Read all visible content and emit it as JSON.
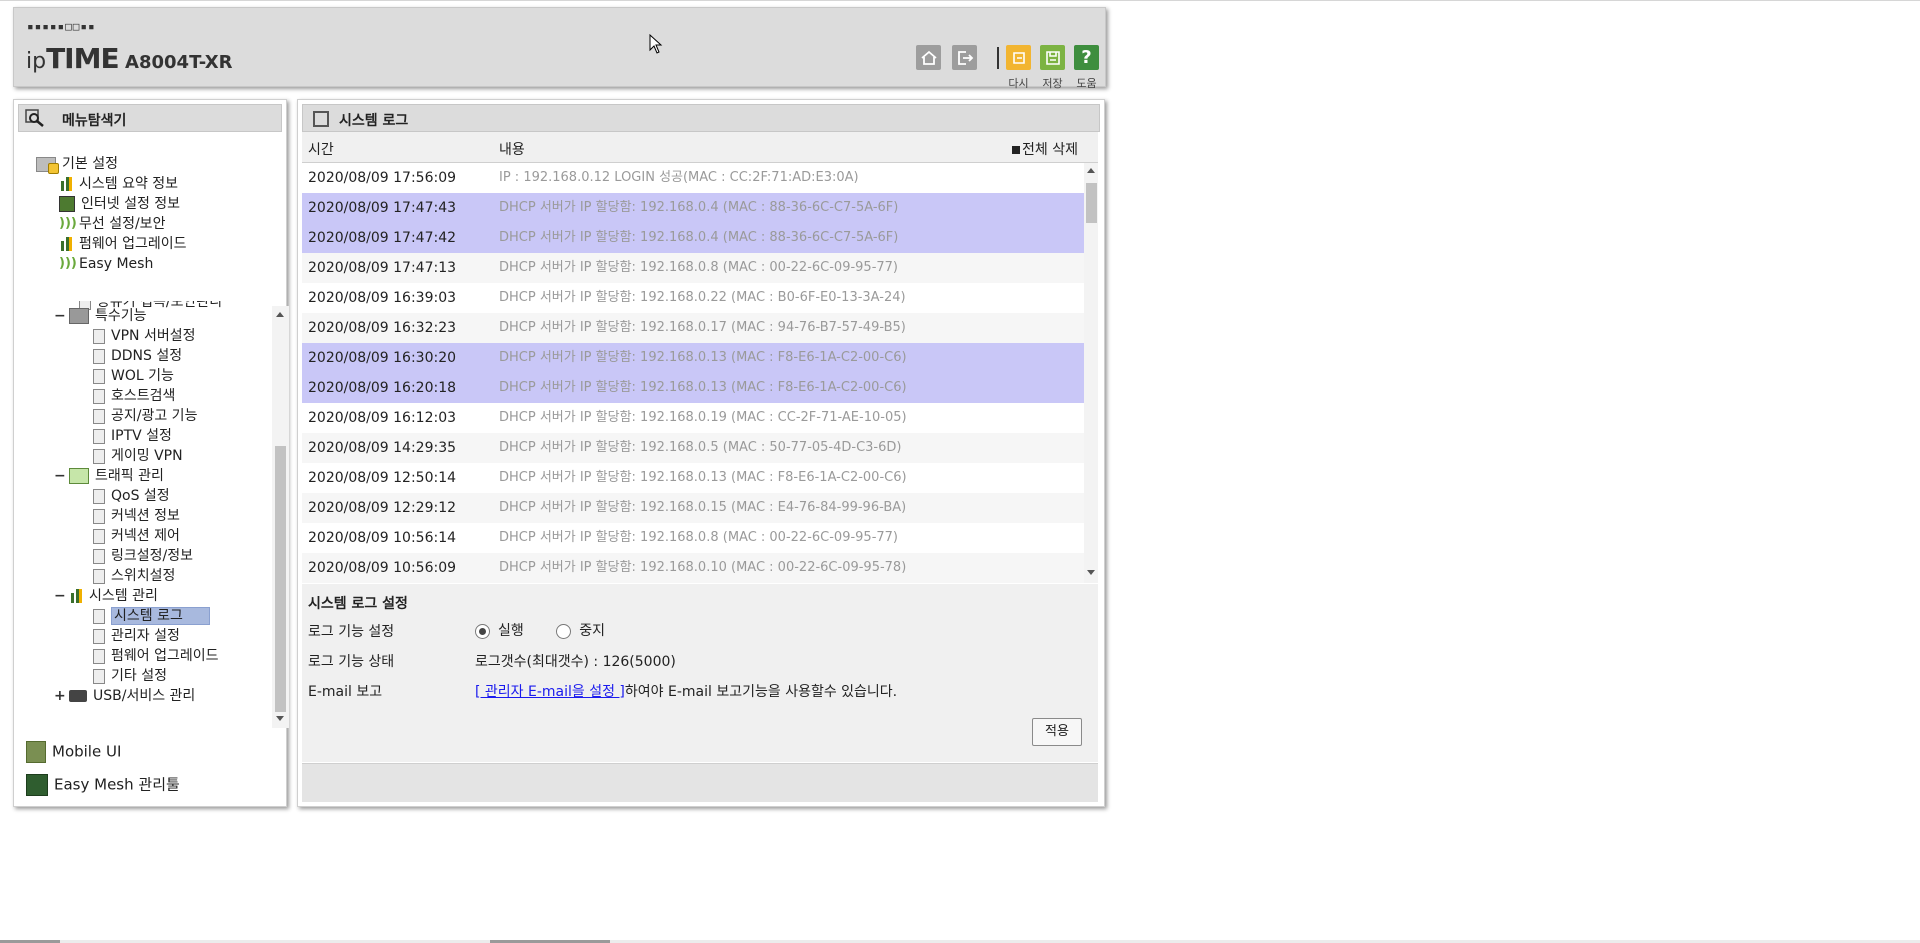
{
  "header": {
    "logo_dots": "▪▪▪▪▪□□▪▪",
    "logo_ip": "ip",
    "logo_time": "TIME",
    "model": "A8004T-XR",
    "buttons": [
      {
        "name": "home",
        "icon": "home-icon",
        "label": ""
      },
      {
        "name": "logout",
        "icon": "logout-icon",
        "label": ""
      },
      {
        "name": "reload",
        "icon": "reload-icon",
        "label": "다시"
      },
      {
        "name": "save",
        "icon": "save-icon",
        "label": "저장"
      },
      {
        "name": "help",
        "icon": "help-icon",
        "label": "도움",
        "glyph": "?"
      }
    ]
  },
  "left": {
    "title": "메뉴탐색기",
    "favorites": {
      "root": "기본 설정",
      "items": [
        "시스템 요약 정보",
        "인터넷 설정 정보",
        "무선 설정/보안",
        "펌웨어 업그레이드",
        "Easy Mesh"
      ]
    },
    "tree": {
      "cut_item": "공유기 접속/보안관리",
      "special": {
        "label": "특수기능",
        "items": [
          "VPN 서버설정",
          "DDNS 설정",
          "WOL 기능",
          "호스트검색",
          "공지/광고 기능",
          "IPTV 설정",
          "게이밍 VPN"
        ]
      },
      "traffic": {
        "label": "트래픽 관리",
        "items": [
          "QoS 설정",
          "커넥션 정보",
          "커넥션 제어",
          "링크설정/정보",
          "스위치설정"
        ]
      },
      "system": {
        "label": "시스템 관리",
        "items": [
          "시스템 로그",
          "관리자 설정",
          "펌웨어 업그레이드",
          "기타 설정"
        ]
      },
      "usb": {
        "label": "USB/서비스 관리"
      }
    },
    "links": [
      "Mobile UI",
      "Easy Mesh 관리툴"
    ]
  },
  "main": {
    "title": "시스템 로그",
    "col_time": "시간",
    "col_msg": "내용",
    "delete_all": "전체 삭제",
    "rows": [
      {
        "time": "2020/08/09 17:56:09",
        "msg": "IP : 192.168.0.12 LOGIN 성공(MAC : CC:2F:71:AD:E3:0A)",
        "hl": false
      },
      {
        "time": "2020/08/09 17:47:43",
        "msg": "DHCP 서버가 IP 할당함: 192.168.0.4 (MAC : 88-36-6C-C7-5A-6F)",
        "hl": true
      },
      {
        "time": "2020/08/09 17:47:42",
        "msg": "DHCP 서버가 IP 할당함: 192.168.0.4 (MAC : 88-36-6C-C7-5A-6F)",
        "hl": true
      },
      {
        "time": "2020/08/09 17:47:13",
        "msg": "DHCP 서버가 IP 할당함: 192.168.0.8 (MAC : 00-22-6C-09-95-77)",
        "hl": false
      },
      {
        "time": "2020/08/09 16:39:03",
        "msg": "DHCP 서버가 IP 할당함: 192.168.0.22 (MAC : B0-6F-E0-13-3A-24)",
        "hl": false
      },
      {
        "time": "2020/08/09 16:32:23",
        "msg": "DHCP 서버가 IP 할당함: 192.168.0.17 (MAC : 94-76-B7-57-49-B5)",
        "hl": false
      },
      {
        "time": "2020/08/09 16:30:20",
        "msg": "DHCP 서버가 IP 할당함: 192.168.0.13 (MAC : F8-E6-1A-C2-00-C6)",
        "hl": true
      },
      {
        "time": "2020/08/09 16:20:18",
        "msg": "DHCP 서버가 IP 할당함: 192.168.0.13 (MAC : F8-E6-1A-C2-00-C6)",
        "hl": true
      },
      {
        "time": "2020/08/09 16:12:03",
        "msg": "DHCP 서버가 IP 할당함: 192.168.0.19 (MAC : CC-2F-71-AE-10-05)",
        "hl": false
      },
      {
        "time": "2020/08/09 14:29:35",
        "msg": "DHCP 서버가 IP 할당함: 192.168.0.5 (MAC : 50-77-05-4D-C3-6D)",
        "hl": false
      },
      {
        "time": "2020/08/09 12:50:14",
        "msg": "DHCP 서버가 IP 할당함: 192.168.0.13 (MAC : F8-E6-1A-C2-00-C6)",
        "hl": false
      },
      {
        "time": "2020/08/09 12:29:12",
        "msg": "DHCP 서버가 IP 할당함: 192.168.0.15 (MAC : E4-76-84-99-96-BA)",
        "hl": false
      },
      {
        "time": "2020/08/09 10:56:14",
        "msg": "DHCP 서버가 IP 할당함: 192.168.0.8 (MAC : 00-22-6C-09-95-77)",
        "hl": false
      },
      {
        "time": "2020/08/09 10:56:09",
        "msg": "DHCP 서버가 IP 할당함: 192.168.0.10 (MAC : 00-22-6C-09-95-78)",
        "hl": false
      }
    ],
    "settings": {
      "title": "시스템 로그 설정",
      "log_func_label": "로그 기능 설정",
      "radio_on": "실행",
      "radio_off": "중지",
      "log_status_label": "로그 기능 상태",
      "log_status_value": "로그갯수(최대갯수) : 126(5000)",
      "email_label": "E-mail 보고",
      "email_link": "[ 관리자 E-mail을 설정 ]",
      "email_text": "하여야 E-mail 보고기능을 사용할수 있습니다.",
      "apply": "적용"
    }
  }
}
